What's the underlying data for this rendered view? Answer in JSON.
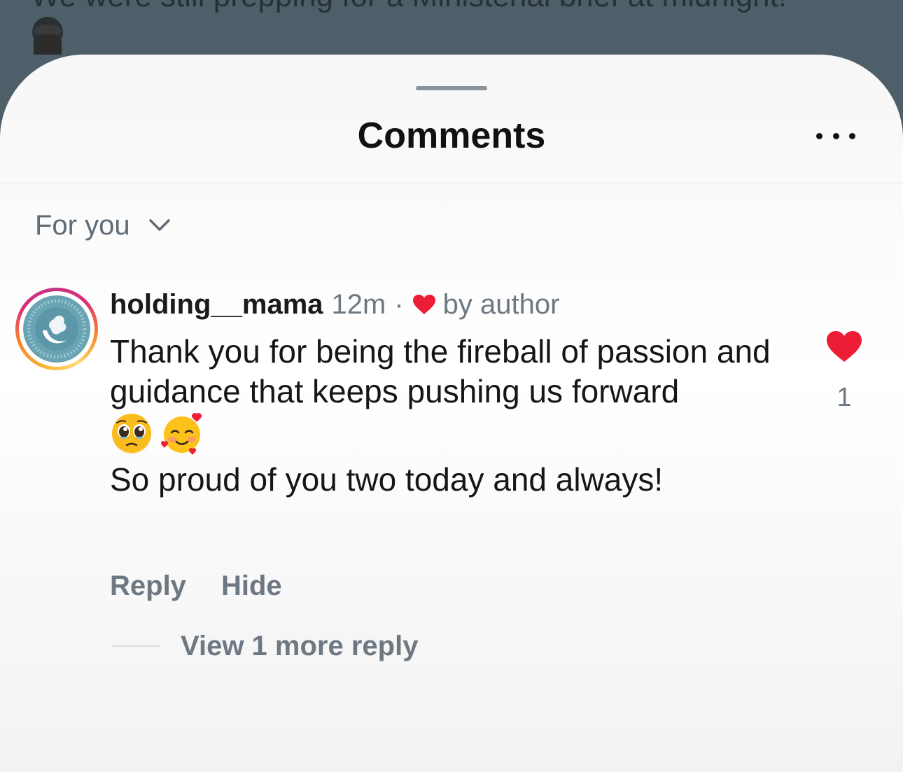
{
  "background": {
    "caption": "We were still prepping for a Ministerial brief at midnight!",
    "emoji_icon": "see-no-evil-monkey-icon"
  },
  "sheet": {
    "title": "Comments",
    "more_icon": "more-horizontal-icon"
  },
  "filter": {
    "label": "For you",
    "icon": "chevron-down-icon"
  },
  "comment": {
    "username": "holding__mama",
    "time": "12m",
    "separator": "·",
    "author_badge_icon": "heart-icon",
    "author_badge": "by author",
    "text_line": "Thank you for being the fireball of passion and guidance that keeps pushing us forward",
    "emojis": [
      "pleading-face-icon",
      "smiling-face-with-hearts-icon"
    ],
    "text_line_2": "So proud of you two today and always!",
    "like_icon": "heart-icon",
    "like_count": "1",
    "actions": {
      "reply": "Reply",
      "hide": "Hide"
    },
    "view_replies": "View 1 more reply"
  },
  "colors": {
    "heart": "#ee1d36",
    "muted_text": "#6d7882",
    "backdrop": "#4f5f69"
  }
}
